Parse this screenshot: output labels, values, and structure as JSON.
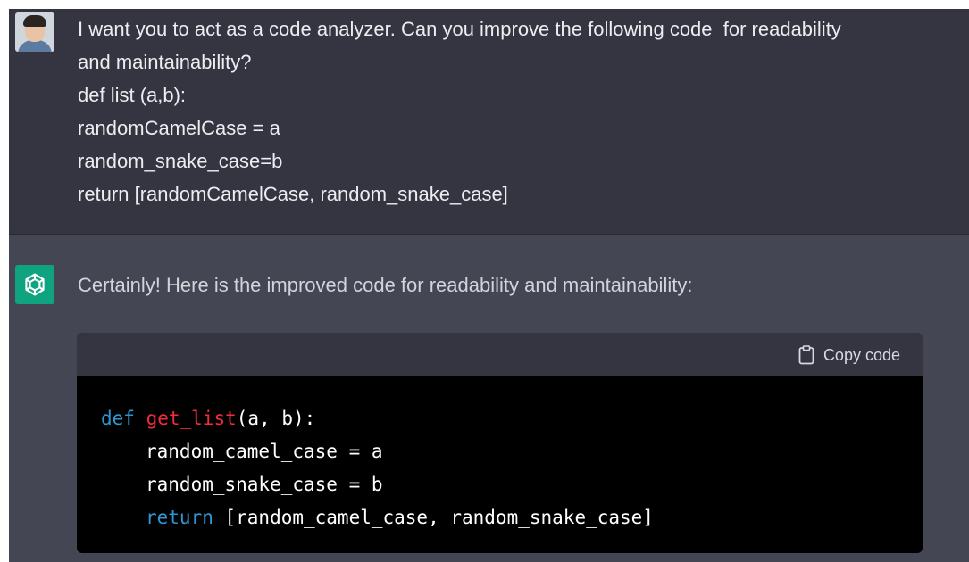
{
  "user_message": {
    "lines": [
      "I want you to act as a code analyzer. Can you improve the following code  for readability",
      "and maintainability?",
      "def list (a,b):",
      "randomCamelCase = a",
      "random_snake_case=b",
      "return [randomCamelCase, random_snake_case]"
    ]
  },
  "assistant_message": {
    "intro": "Certainly! Here is the improved code for readability and maintainability:",
    "code_block": {
      "copy_label": "Copy code",
      "lines": [
        {
          "keyword": "def",
          "function": "get_list",
          "rest": "(a, b):"
        },
        {
          "text": "random_camel_case = a"
        },
        {
          "text": "random_snake_case = b"
        },
        {
          "keyword": "return",
          "rest": " [random_camel_case, random_snake_case]"
        }
      ]
    }
  },
  "colors": {
    "user_bg": "#343541",
    "assistant_bg": "#444654",
    "bot_avatar": "#10a37f",
    "code_bg": "#000000",
    "keyword": "#2e95d3",
    "function_name": "#f22c3d"
  },
  "icons": {
    "bot_avatar": "openai-logo-icon",
    "copy": "clipboard-icon"
  }
}
